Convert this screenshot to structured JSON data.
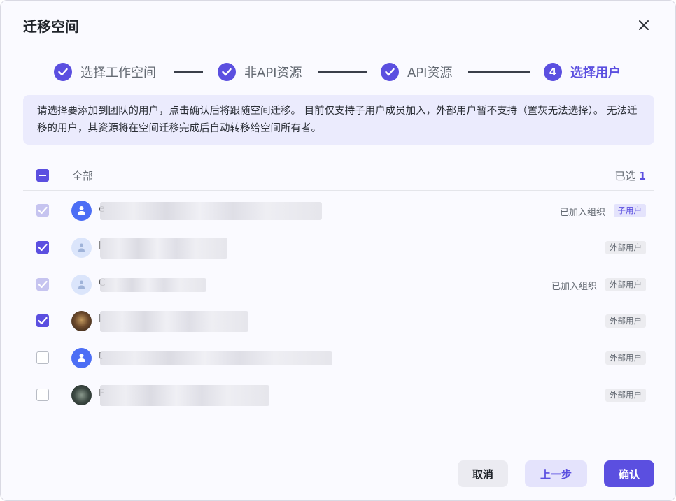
{
  "dialog": {
    "title": "迁移空间",
    "close_icon": "close-icon"
  },
  "steps": [
    {
      "label": "选择工作空间",
      "status": "done"
    },
    {
      "label": "非API资源",
      "status": "done"
    },
    {
      "label": "API资源",
      "status": "done"
    },
    {
      "number": "4",
      "label": "选择用户",
      "status": "active"
    }
  ],
  "notice": {
    "text": "请选择要添加到团队的用户，点击确认后将跟随空间迁移。 目前仅支持子用户成员加入，外部用户暂不支持（置灰无法选择）。 无法迁移的用户，其资源将在空间迁移完成后自动转移给空间所有者。"
  },
  "list_header": {
    "all_label": "全部",
    "selected_label": "已选",
    "selected_count": "1"
  },
  "users": [
    {
      "initial": "e",
      "joined": "已加入组织",
      "tag": "子用户",
      "checkbox": "checked-disabled"
    },
    {
      "initial": "l",
      "joined": "",
      "tag": "外部用户",
      "checkbox": "checked"
    },
    {
      "initial": "C",
      "joined": "已加入组织",
      "tag": "外部用户",
      "checkbox": "checked-disabled"
    },
    {
      "initial": "l",
      "joined": "",
      "tag": "外部用户",
      "checkbox": "checked"
    },
    {
      "initial": "t",
      "joined": "",
      "tag": "外部用户",
      "checkbox": "unchecked"
    },
    {
      "initial": "F",
      "joined": "",
      "tag": "外部用户",
      "checkbox": "unchecked"
    }
  ],
  "footer": {
    "cancel_label": "取消",
    "prev_label": "上一步",
    "confirm_label": "确认"
  },
  "colors": {
    "accent": "#5b4fe0",
    "notice_bg": "#ebebfd"
  }
}
